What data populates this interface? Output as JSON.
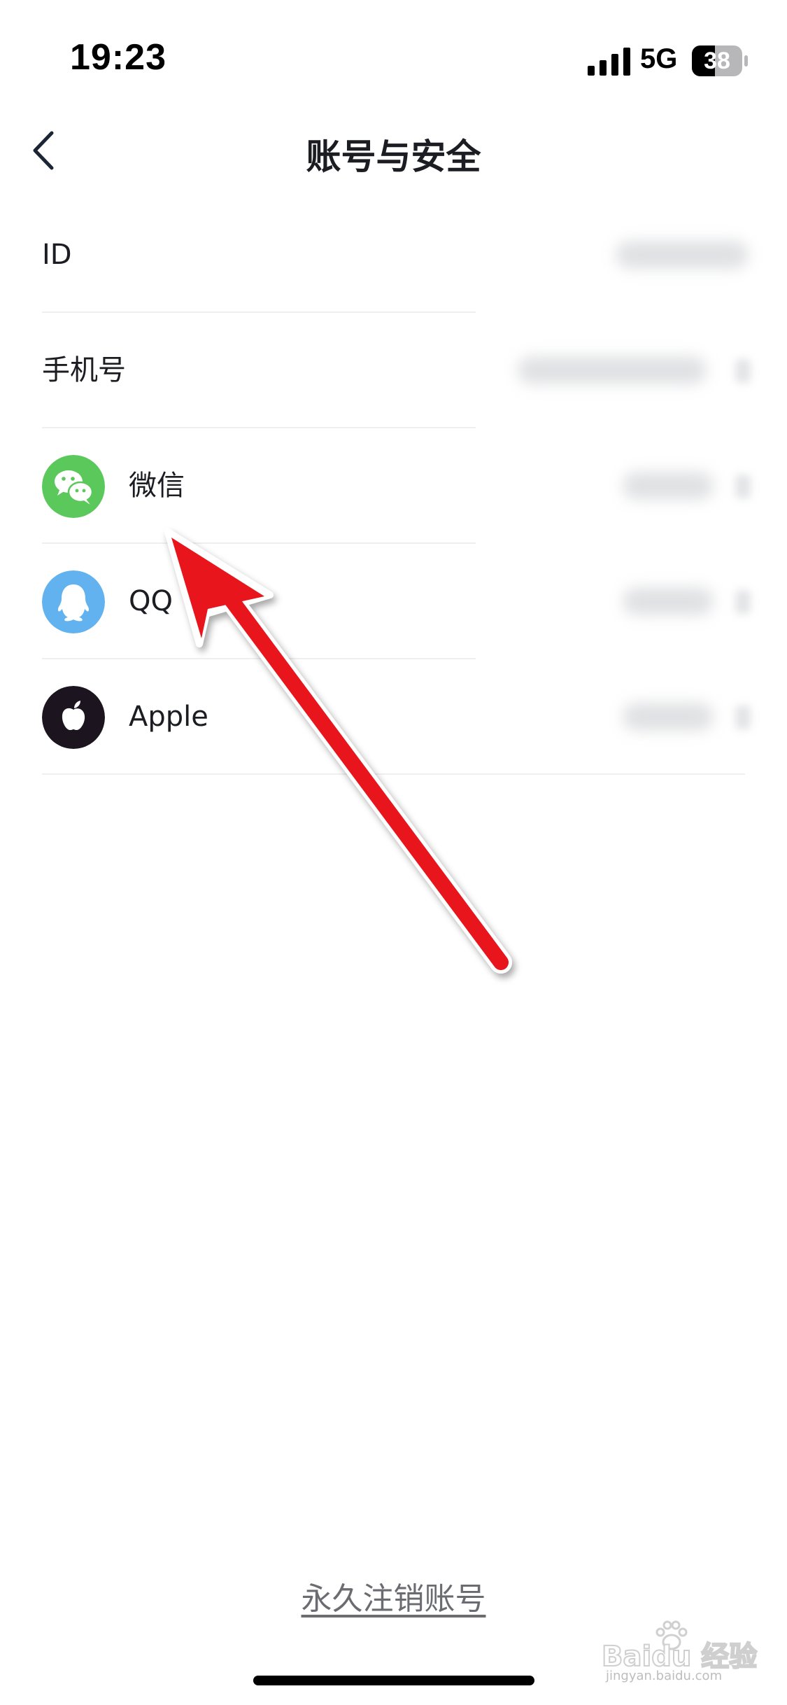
{
  "status_bar": {
    "time": "19:23",
    "network": "5G",
    "battery": "38"
  },
  "nav": {
    "title": "账号与安全"
  },
  "rows": {
    "id": {
      "label": "ID"
    },
    "phone": {
      "label": "手机号"
    },
    "wechat": {
      "label": "微信",
      "icon": "wechat-icon",
      "color": "#5ac85a"
    },
    "qq": {
      "label": "QQ",
      "icon": "qq-penguin-icon",
      "color": "#62b2f0"
    },
    "apple": {
      "label": "Apple",
      "icon": "apple-icon",
      "color": "#1c1520"
    }
  },
  "footer": {
    "delete_account": "永久注销账号"
  },
  "colors": {
    "arrow": "#e8121c",
    "divider": "#efeff2"
  },
  "watermark": {
    "brand": "Baidu 经验",
    "url": "jingyan.baidu.com"
  }
}
